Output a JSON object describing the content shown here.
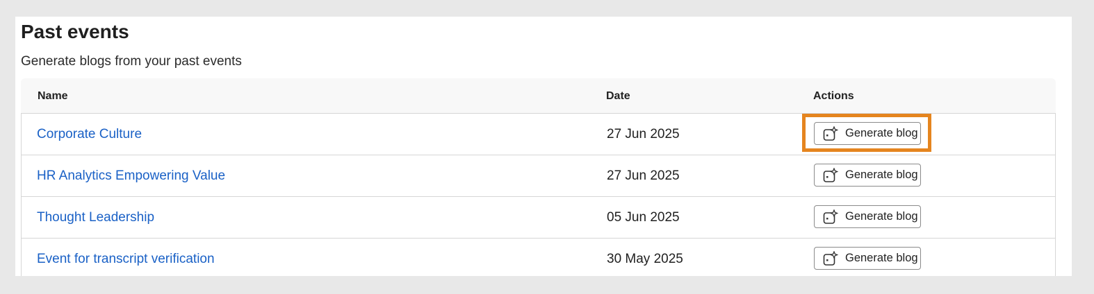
{
  "page": {
    "title": "Past events",
    "subtitle": "Generate blogs from your past events"
  },
  "table": {
    "columns": [
      "Name",
      "Date",
      "Actions"
    ],
    "rows": [
      {
        "name": "Corporate Culture",
        "date": "27 Jun 2025",
        "action": "Generate blog"
      },
      {
        "name": "HR Analytics Empowering Value",
        "date": "27 Jun 2025",
        "action": "Generate blog"
      },
      {
        "name": "Thought Leadership",
        "date": "05 Jun 2025",
        "action": "Generate blog"
      },
      {
        "name": "Event for transcript verification",
        "date": "30 May 2025",
        "action": "Generate blog"
      }
    ]
  },
  "colors": {
    "link": "#1a61c6",
    "highlight": "#e5851f"
  },
  "icons": {
    "generate": "ai-sparkle-icon"
  }
}
